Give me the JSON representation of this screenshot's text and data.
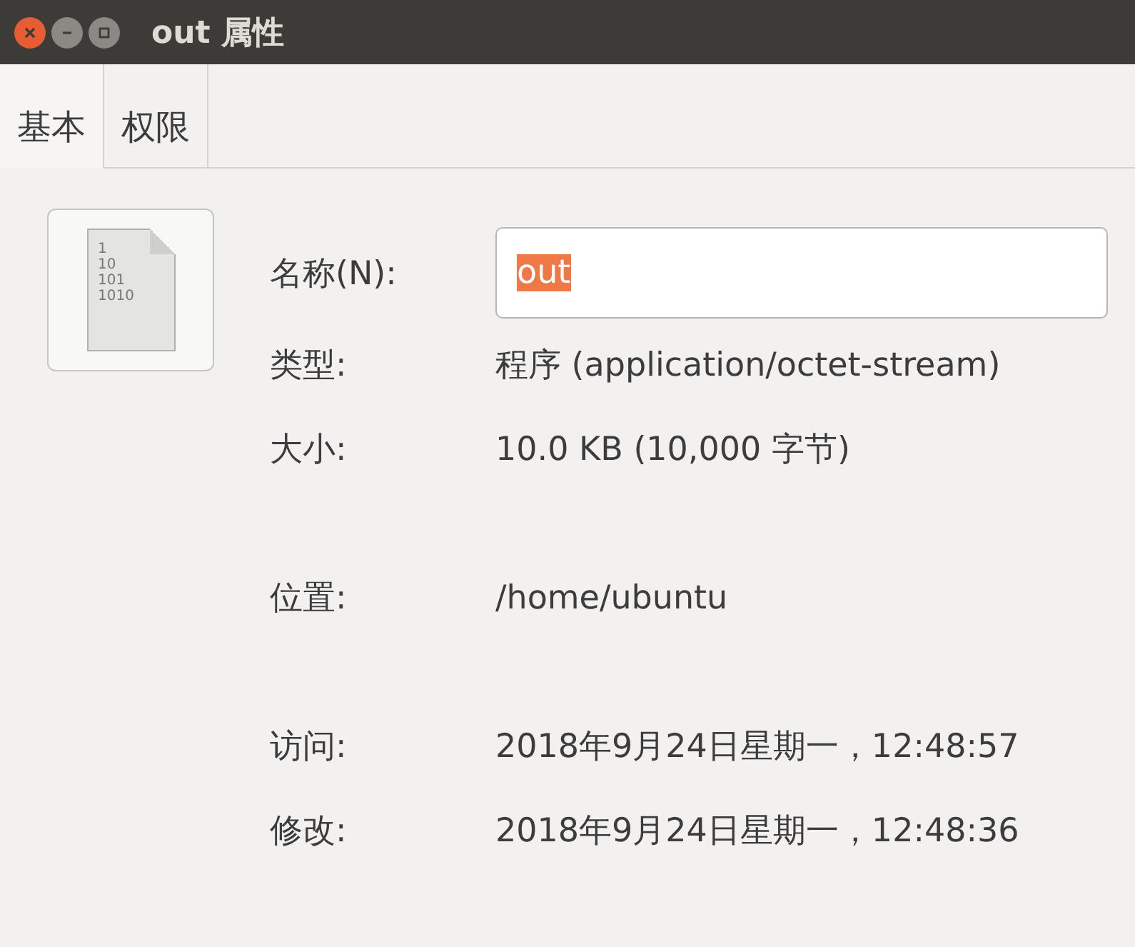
{
  "window": {
    "title": "out 属性"
  },
  "tabs": [
    {
      "label": "基本",
      "selected": true
    },
    {
      "label": "权限",
      "selected": false
    }
  ],
  "file_icon_lines": [
    "1",
    "10",
    "101",
    "1010"
  ],
  "name_field": {
    "label": "名称(N):",
    "value": "out",
    "selected": true
  },
  "groups": [
    [
      {
        "label": "类型:",
        "value": "程序 (application/octet-stream)"
      },
      {
        "label": "大小:",
        "value": "10.0 KB (10,000 字节)"
      }
    ],
    [
      {
        "label": "位置:",
        "value": "/home/ubuntu"
      }
    ],
    [
      {
        "label": "访问:",
        "value": "2018年9月24日星期一，12:48:57"
      },
      {
        "label": "修改:",
        "value": "2018年9月24日星期一，12:48:36"
      }
    ]
  ]
}
